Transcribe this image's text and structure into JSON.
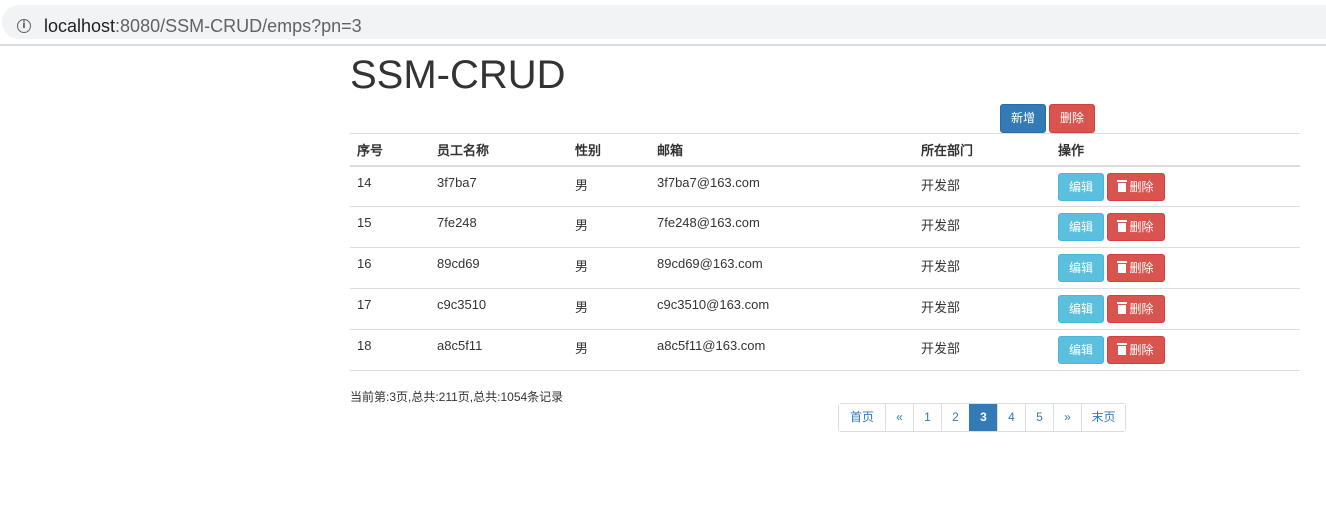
{
  "browser": {
    "url_host": "localhost",
    "url_rest": ":8080/SSM-CRUD/emps?pn=3",
    "info_icon": "i"
  },
  "page": {
    "title": "SSM-CRUD",
    "add_label": "新增",
    "delete_label": "删除"
  },
  "table": {
    "headers": [
      "序号",
      "员工名称",
      "性别",
      "邮箱",
      "所在部门",
      "操作"
    ],
    "rows": [
      {
        "id": "14",
        "name": "3f7ba7",
        "gender": "男",
        "email": "3f7ba7@163.com",
        "dept": "开发部"
      },
      {
        "id": "15",
        "name": "7fe248",
        "gender": "男",
        "email": "7fe248@163.com",
        "dept": "开发部"
      },
      {
        "id": "16",
        "name": "89cd69",
        "gender": "男",
        "email": "89cd69@163.com",
        "dept": "开发部"
      },
      {
        "id": "17",
        "name": "c9c3510",
        "gender": "男",
        "email": "c9c3510@163.com",
        "dept": "开发部"
      },
      {
        "id": "18",
        "name": "a8c5f11",
        "gender": "男",
        "email": "a8c5f11@163.com",
        "dept": "开发部"
      }
    ],
    "edit_label": "编辑",
    "row_delete_label": "删除"
  },
  "pagination": {
    "info": "当前第:3页,总共:211页,总共:1054条记录",
    "first": "首页",
    "prev": "«",
    "pages": [
      "1",
      "2",
      "3",
      "4",
      "5"
    ],
    "current": "3",
    "next": "»",
    "last": "末页"
  },
  "colors": {
    "primary": "#337ab7",
    "danger": "#d9534f",
    "info": "#5bc0de"
  }
}
